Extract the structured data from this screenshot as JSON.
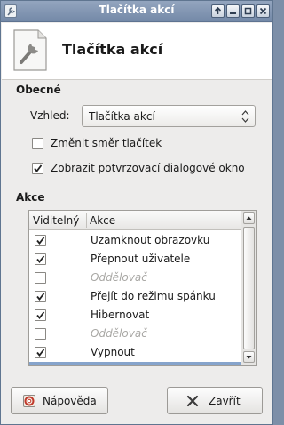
{
  "window": {
    "title": "Tlačítka akcí",
    "app_icon": "wrench-icon",
    "controls": [
      "maximize-icon",
      "minimize-icon",
      "restore-icon",
      "close-icon"
    ]
  },
  "header": {
    "title": "Tlačítka akcí",
    "icon": "settings-wrench-icon"
  },
  "general": {
    "section_label": "Obecné",
    "appearance_label": "Vzhled:",
    "appearance_value": "Tlačítka akcí",
    "reverse_checkbox": {
      "label": "Změnit směr tlačítek",
      "checked": false
    },
    "confirm_checkbox": {
      "label": "Zobrazit potvrzovací dialogové okno",
      "checked": true
    }
  },
  "actions": {
    "section_label": "Akce",
    "columns": [
      "Viditelný",
      "Akce"
    ],
    "items": [
      {
        "label": "Uzamknout obrazovku",
        "checked": true,
        "separator": false
      },
      {
        "label": "Přepnout uživatele",
        "checked": true,
        "separator": false
      },
      {
        "label": "Oddělovač",
        "checked": false,
        "separator": true
      },
      {
        "label": "Přejít do režimu spánku",
        "checked": true,
        "separator": false
      },
      {
        "label": "Hibernovat",
        "checked": true,
        "separator": false
      },
      {
        "label": "Oddělovač",
        "checked": false,
        "separator": true
      },
      {
        "label": "Vypnout",
        "checked": true,
        "separator": false
      }
    ]
  },
  "buttons": {
    "help_label": "Nápověda",
    "close_label": "Zavřít"
  },
  "colors": {
    "titlebar": "#7f93b0",
    "selection": "#86a4cc",
    "separator_text": "#a9a8a5"
  }
}
